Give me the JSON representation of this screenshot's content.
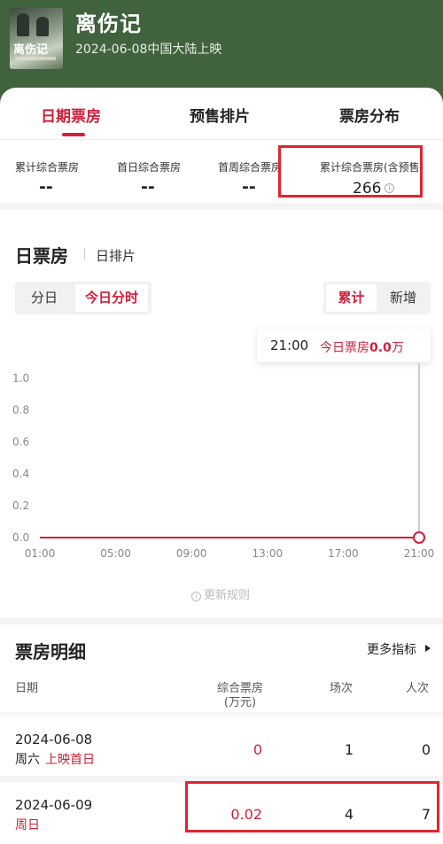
{
  "movie": {
    "title": "离伤记",
    "release": "2024-06-08中国大陆上映",
    "poster_text": "离伤记"
  },
  "tabs": [
    {
      "label": "日期票房",
      "active": true
    },
    {
      "label": "预售排片",
      "active": false
    },
    {
      "label": "票房分布",
      "active": false
    }
  ],
  "stats": [
    {
      "label": "累计综合票房",
      "value": "--"
    },
    {
      "label": "首日综合票房",
      "value": "--"
    },
    {
      "label": "首周综合票房",
      "value": "--"
    },
    {
      "label": "累计综合票房(含预售)",
      "value": "266"
    }
  ],
  "daily": {
    "title": "日票房",
    "subtitle": "日排片",
    "view_toggle": [
      {
        "label": "分日",
        "active": false
      },
      {
        "label": "今日分时",
        "active": true
      }
    ],
    "mode_toggle": [
      {
        "label": "累计",
        "active": true
      },
      {
        "label": "新增",
        "active": false
      }
    ],
    "tooltip": {
      "time": "21:00",
      "label": "今日票房",
      "value": "0.0",
      "unit": "万"
    },
    "update_rule": "更新规则"
  },
  "chart_data": {
    "type": "line",
    "x": [
      "01:00",
      "05:00",
      "09:00",
      "13:00",
      "17:00",
      "21:00"
    ],
    "series": [
      {
        "values": [
          0,
          0,
          0,
          0,
          0,
          0
        ]
      }
    ],
    "yticks": [
      "0.0",
      "0.2",
      "0.4",
      "0.6",
      "0.8",
      "1.0"
    ],
    "ylim": [
      0,
      1.0
    ],
    "grid": false,
    "highlight_x": "21:00",
    "colors": {
      "line": "#d0203a",
      "axis": "#dddddd"
    }
  },
  "detail": {
    "title": "票房明细",
    "more_label": "更多指标",
    "headers": {
      "date": "日期",
      "box_line1": "综合票房",
      "box_line2": "(万元)",
      "shows": "场次",
      "people": "人次"
    },
    "rows": [
      {
        "date": "2024-06-08",
        "weekday": "周六",
        "tag": "上映首日",
        "box": "0",
        "shows": "1",
        "people": "0"
      },
      {
        "date": "2024-06-09",
        "weekday": "周日",
        "tag": "",
        "box": "0.02",
        "shows": "4",
        "people": "7"
      }
    ]
  },
  "colors": {
    "accent": "#d0203a",
    "header_bg": "#40623d",
    "highlight_box": "#e0242f"
  }
}
